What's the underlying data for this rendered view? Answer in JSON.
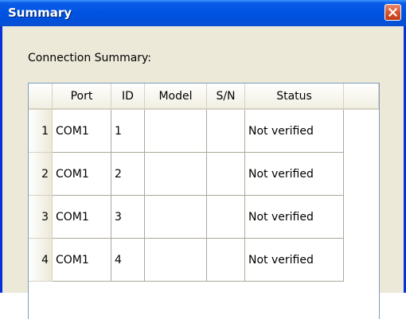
{
  "window": {
    "title": "Summary"
  },
  "section_label": "Connection Summary:",
  "grid": {
    "columns": [
      "",
      "Port",
      "ID",
      "Model",
      "S/N",
      "Status",
      ""
    ],
    "rows": [
      {
        "index": "1",
        "port": "COM1",
        "id": "1",
        "model": "",
        "sn": "",
        "status": "Not verified"
      },
      {
        "index": "2",
        "port": "COM1",
        "id": "2",
        "model": "",
        "sn": "",
        "status": "Not verified"
      },
      {
        "index": "3",
        "port": "COM1",
        "id": "3",
        "model": "",
        "sn": "",
        "status": "Not verified"
      },
      {
        "index": "4",
        "port": "COM1",
        "id": "4",
        "model": "",
        "sn": "",
        "status": "Not verified"
      }
    ]
  },
  "colors": {
    "title_bar": "#0054e3",
    "close_button": "#d8542e",
    "window_bg": "#ece9d8"
  },
  "icons": {
    "close": "close-icon"
  }
}
